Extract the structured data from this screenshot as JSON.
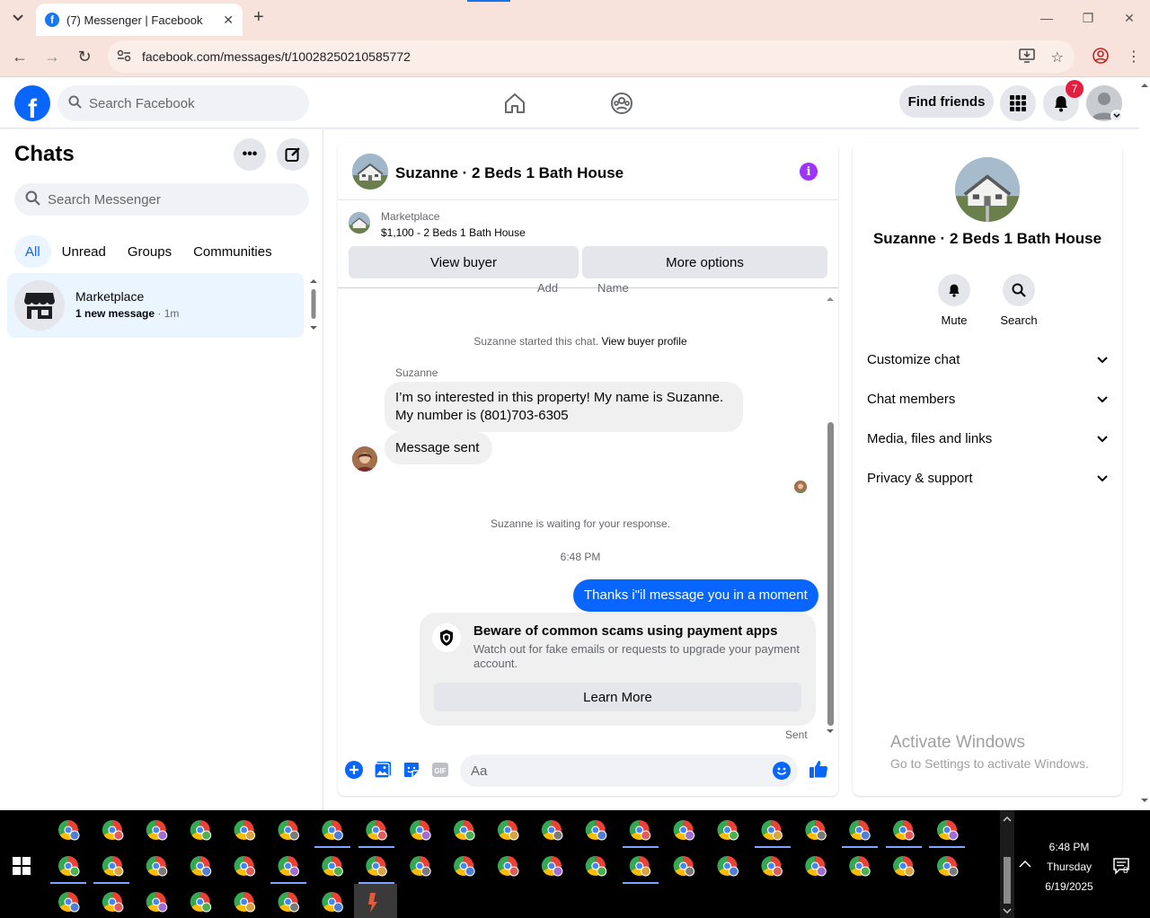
{
  "browser": {
    "tab_title": "(7) Messenger | Facebook",
    "url": "facebook.com/messages/t/10028250210585772"
  },
  "header": {
    "search_placeholder": "Search Facebook",
    "find_friends": "Find friends",
    "notifications_count": "7"
  },
  "sidebar": {
    "title": "Chats",
    "search_placeholder": "Search Messenger",
    "filters": [
      "All",
      "Unread",
      "Groups",
      "Communities"
    ],
    "chat": {
      "name": "Marketplace",
      "preview": "1 new message",
      "time": " · 1m"
    }
  },
  "conversation": {
    "title": "Suzanne · 2 Beds 1 Bath House",
    "marketplace_label": "Marketplace",
    "listing": "$1,100 - 2 Beds 1 Bath House",
    "view_buyer": "View buyer",
    "more_options": "More options",
    "cut_left": "Add",
    "cut_right": "Name",
    "started_text": "Suzanne started this chat.",
    "view_buyer_profile": "View buyer profile",
    "sender_name": "Suzanne",
    "msg1_line1": "I’m so interested in this property! My name is Suzanne.",
    "msg1_line2": "My number is (801)703-6305",
    "msg2": "Message sent",
    "waiting": "Suzanne is waiting for your response.",
    "timestamp": "6:48 PM",
    "out_msg": "Thanks i\"il message you in a moment",
    "scam_title": "Beware of common scams using payment apps",
    "scam_body": "Watch out for fake emails or requests to upgrade your payment account.",
    "learn_more": "Learn More",
    "sent": "Sent",
    "composer_placeholder": "Aa"
  },
  "details": {
    "name": "Suzanne · 2 Beds 1 Bath House",
    "mute": "Mute",
    "search": "Search",
    "rows": [
      "Customize chat",
      "Chat members",
      "Media, files and links",
      "Privacy & support"
    ]
  },
  "watermark": {
    "line1": "Activate Windows",
    "line2": "Go to Settings to activate Windows."
  },
  "taskbar": {
    "time": "6:48 PM",
    "day": "Thursday",
    "date": "6/19/2025",
    "notif_count": "8"
  },
  "colors": {
    "fb_blue": "#0866ff",
    "badge_red": "#e41e3f",
    "info_purple": "#a033ff",
    "chrome_bg": "#f8e3dc"
  }
}
